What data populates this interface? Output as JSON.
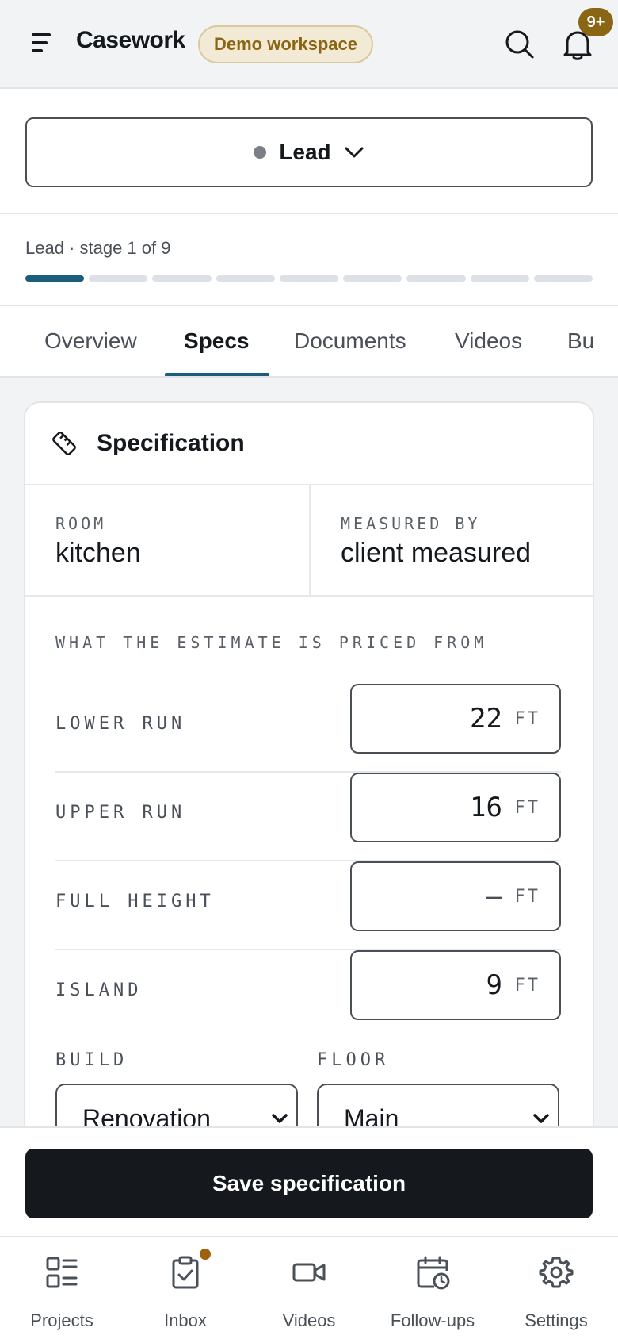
{
  "header": {
    "brand": "Casework",
    "workspace_badge": "Demo workspace",
    "notifications_count": "9+",
    "icons": [
      "menu-icon",
      "search-icon",
      "bell-icon"
    ]
  },
  "stage": {
    "label": "Lead",
    "progress_text": "Lead · stage 1 of 9",
    "current": 1,
    "total": 9
  },
  "tabs": [
    {
      "label": "Overview",
      "active": false
    },
    {
      "label": "Specs",
      "active": true
    },
    {
      "label": "Documents",
      "active": false
    },
    {
      "label": "Videos",
      "active": false
    },
    {
      "label": "Bu",
      "active": false
    }
  ],
  "card": {
    "title": "Specification",
    "icon": "ruler-icon",
    "room_label": "ROOM",
    "room_value": "kitchen",
    "measured_by_label": "MEASURED BY",
    "measured_by_value": "client measured",
    "section_label": "WHAT THE ESTIMATE IS PRICED FROM",
    "rows": [
      {
        "label": "LOWER RUN",
        "value": "22",
        "unit": "FT"
      },
      {
        "label": "UPPER RUN",
        "value": "16",
        "unit": "FT"
      },
      {
        "label": "FULL HEIGHT",
        "value": "—",
        "unit": "FT"
      },
      {
        "label": "ISLAND",
        "value": "9",
        "unit": "FT"
      }
    ],
    "build_label": "BUILD",
    "build_value": "Renovation",
    "floor_label": "FLOOR",
    "floor_value": "Main"
  },
  "save_button": "Save specification",
  "bottom_nav": [
    {
      "label": "Projects",
      "icon": "projects-icon"
    },
    {
      "label": "Inbox",
      "icon": "inbox-icon",
      "has_dot": true
    },
    {
      "label": "Videos",
      "icon": "video-icon"
    },
    {
      "label": "Follow-ups",
      "icon": "calendar-clock-icon"
    },
    {
      "label": "Settings",
      "icon": "gear-icon"
    }
  ],
  "colors": {
    "accent": "#1b5e7a",
    "badge_text": "#8a6614",
    "badge_bg": "#f3ead6",
    "dark": "#15191d"
  }
}
